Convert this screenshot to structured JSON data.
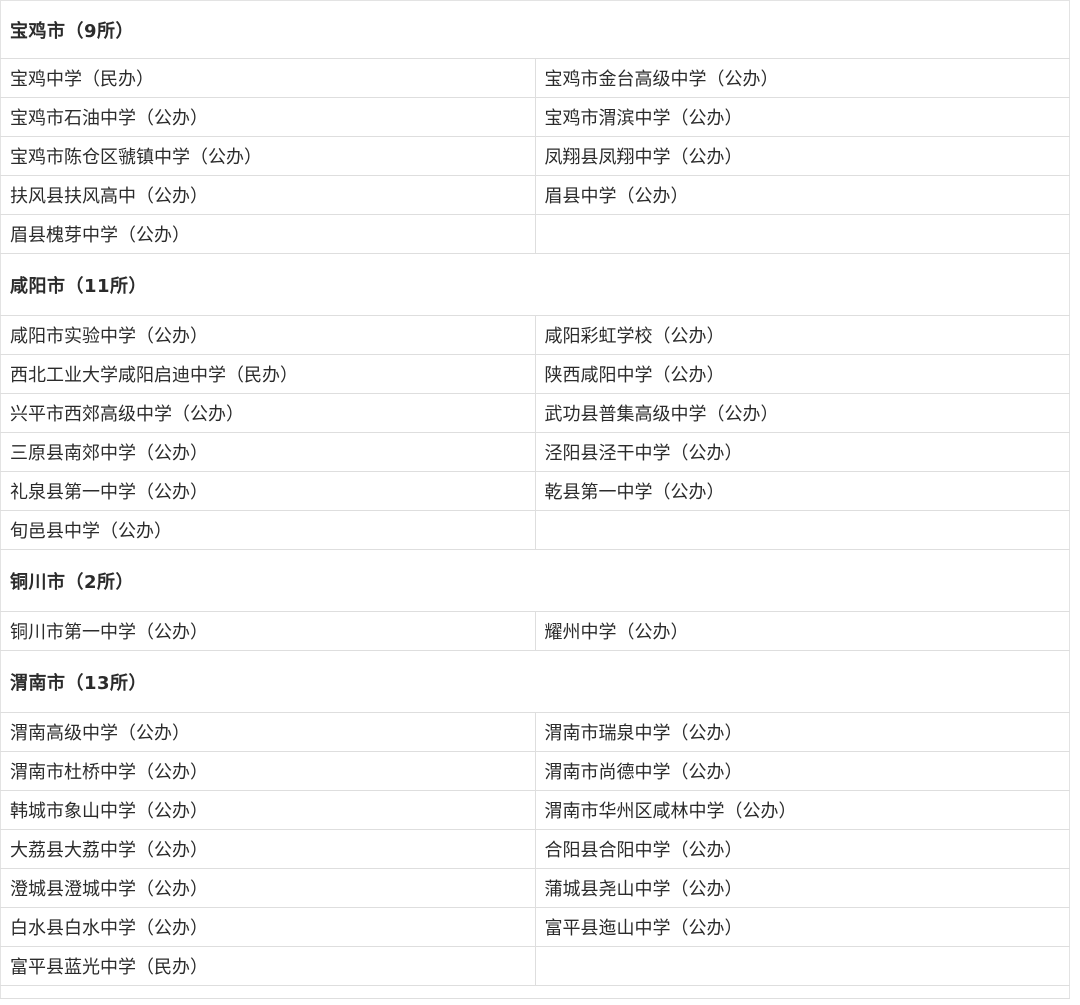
{
  "sections": [
    {
      "heading": "宝鸡市（9所）",
      "rows": [
        [
          "宝鸡中学（民办）",
          "宝鸡市金台高级中学（公办）"
        ],
        [
          "宝鸡市石油中学（公办）",
          "宝鸡市渭滨中学（公办）"
        ],
        [
          "宝鸡市陈仓区虢镇中学（公办）",
          "凤翔县凤翔中学（公办）"
        ],
        [
          "扶风县扶风高中（公办）",
          "眉县中学（公办）"
        ],
        [
          "眉县槐芽中学（公办）",
          ""
        ]
      ]
    },
    {
      "heading": "咸阳市（11所）",
      "rows": [
        [
          "咸阳市实验中学（公办）",
          "咸阳彩虹学校（公办）"
        ],
        [
          "西北工业大学咸阳启迪中学（民办）",
          "陕西咸阳中学（公办）"
        ],
        [
          "兴平市西郊高级中学（公办）",
          "武功县普集高级中学（公办）"
        ],
        [
          "三原县南郊中学（公办）",
          "泾阳县泾干中学（公办）"
        ],
        [
          "礼泉县第一中学（公办）",
          "乾县第一中学（公办）"
        ],
        [
          "旬邑县中学（公办）",
          ""
        ]
      ]
    },
    {
      "heading": "铜川市（2所）",
      "rows": [
        [
          "铜川市第一中学（公办）",
          "耀州中学（公办）"
        ]
      ]
    },
    {
      "heading": "渭南市（13所）",
      "rows": [
        [
          "渭南高级中学（公办）",
          "渭南市瑞泉中学（公办）"
        ],
        [
          "渭南市杜桥中学（公办）",
          "渭南市尚德中学（公办）"
        ],
        [
          "韩城市象山中学（公办）",
          "渭南市华州区咸林中学（公办）"
        ],
        [
          "大荔县大荔中学（公办）",
          "合阳县合阳中学（公办）"
        ],
        [
          "澄城县澄城中学（公办）",
          "蒲城县尧山中学（公办）"
        ],
        [
          "白水县白水中学（公办）",
          "富平县迤山中学（公办）"
        ],
        [
          "富平县蓝光中学（民办）",
          ""
        ]
      ]
    }
  ]
}
